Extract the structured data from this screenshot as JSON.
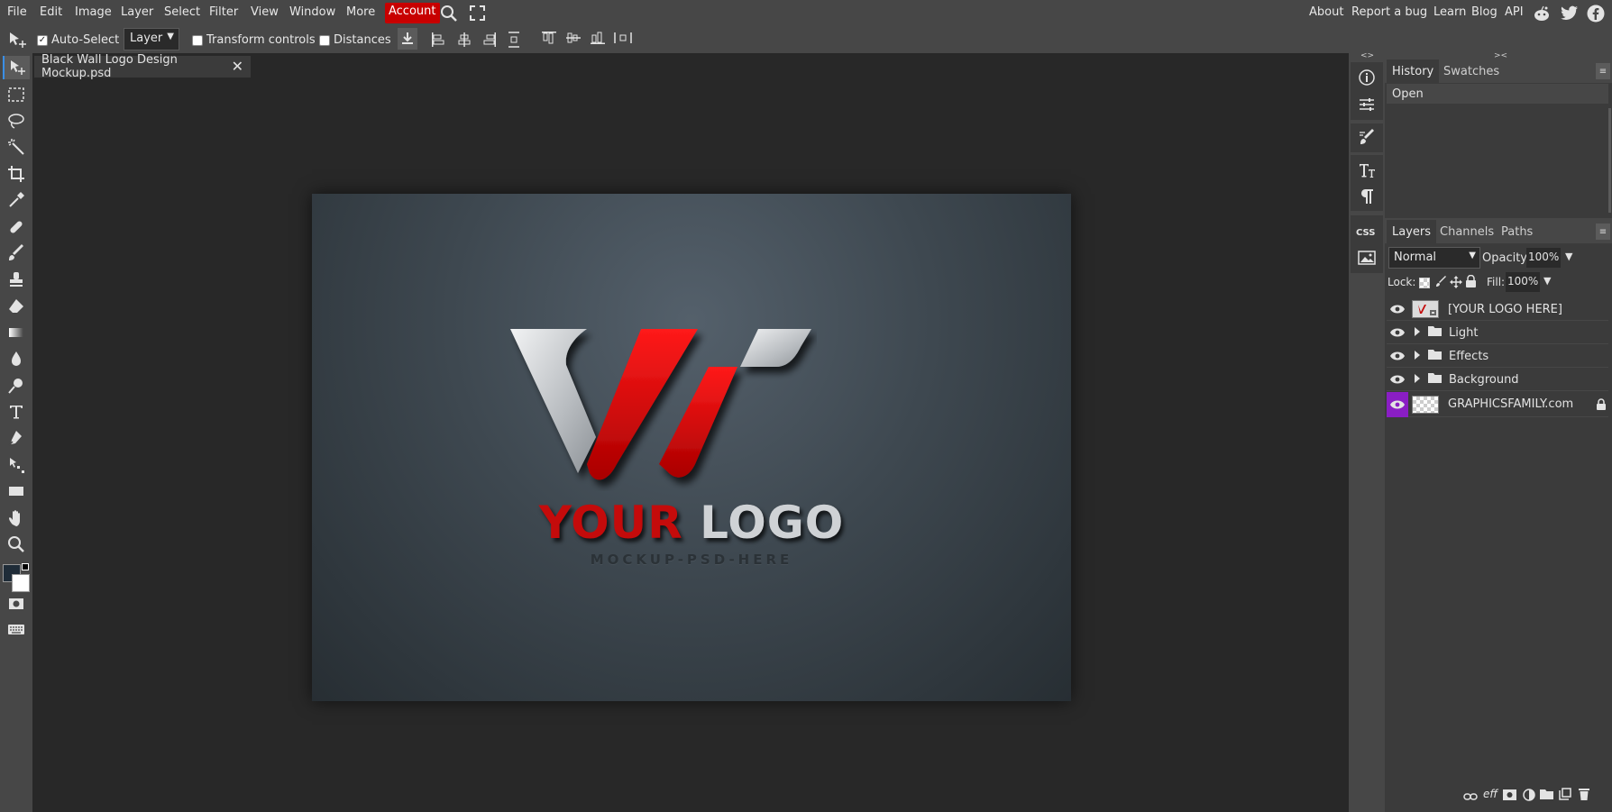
{
  "menu": {
    "items": [
      "File",
      "Edit",
      "Image",
      "Layer",
      "Select",
      "Filter",
      "View",
      "Window",
      "More"
    ],
    "account": "Account",
    "right_links": [
      "About",
      "Report a bug",
      "Learn",
      "Blog",
      "API"
    ]
  },
  "options": {
    "auto_select_label": "Auto-Select",
    "auto_select_checked": true,
    "layer_select_value": "Layer",
    "transform_controls_label": "Transform controls",
    "distances_label": "Distances"
  },
  "document": {
    "tab_title": "Black Wall Logo Design Mockup.psd",
    "logo_word1": "YOUR",
    "logo_word2": "LOGO",
    "logo_subtitle": "MOCKUP-PSD-HERE"
  },
  "history_panel": {
    "tabs": [
      "History",
      "Swatches"
    ],
    "items": [
      "Open"
    ]
  },
  "layers_panel": {
    "tabs": [
      "Layers",
      "Channels",
      "Paths"
    ],
    "blend_mode": "Normal",
    "opacity_label": "Opacity:",
    "opacity_value": "100%",
    "lock_label": "Lock:",
    "fill_label": "Fill:",
    "fill_value": "100%",
    "layers": [
      {
        "name": "[YOUR LOGO HERE]",
        "type": "smart"
      },
      {
        "name": "Light",
        "type": "folder"
      },
      {
        "name": "Effects",
        "type": "folder"
      },
      {
        "name": "Background",
        "type": "folder"
      },
      {
        "name": "GRAPHICSFAMILY.com",
        "type": "layer",
        "locked": true
      }
    ],
    "footer_eff_label": "eff"
  },
  "colors": {
    "accent_account": "#c80000",
    "logo_red": "#c40b0b",
    "logo_silver": "#cfd2d5",
    "selected_eye": "#8a1ec4"
  }
}
